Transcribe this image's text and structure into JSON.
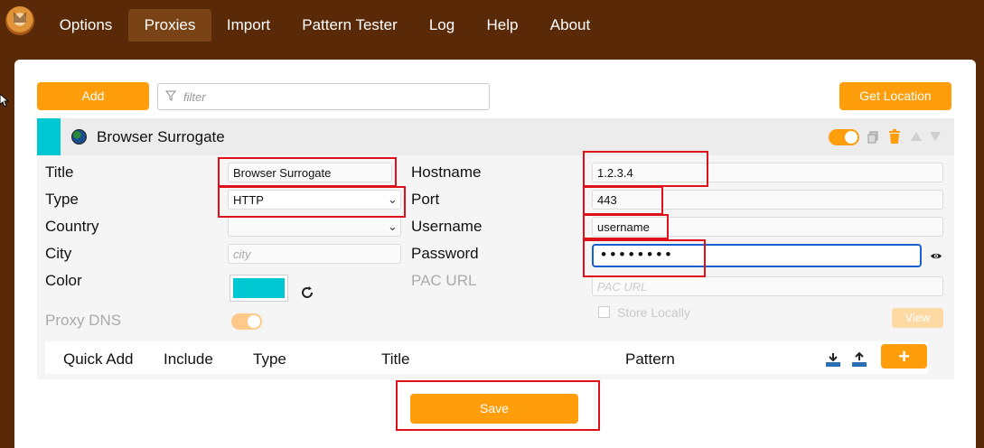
{
  "nav": {
    "tabs": [
      "Options",
      "Proxies",
      "Import",
      "Pattern Tester",
      "Log",
      "Help",
      "About"
    ],
    "active_tab": "Proxies"
  },
  "toolbar": {
    "add_label": "Add",
    "filter_placeholder": "filter",
    "get_location_label": "Get Location"
  },
  "proxy": {
    "name": "Browser Surrogate",
    "color": "#00c8d2",
    "enabled": true
  },
  "form": {
    "title_label": "Title",
    "title_value": "Browser Surrogate",
    "type_label": "Type",
    "type_value": "HTTP",
    "country_label": "Country",
    "country_value": "",
    "city_label": "City",
    "city_placeholder": "city",
    "color_label": "Color",
    "proxy_dns_label": "Proxy DNS",
    "hostname_label": "Hostname",
    "hostname_value": "1.2.3.4",
    "port_label": "Port",
    "port_value": "443",
    "username_label": "Username",
    "username_value": "username",
    "password_label": "Password",
    "password_value": "••••••••",
    "pac_url_label": "PAC URL",
    "pac_url_placeholder": "PAC URL",
    "store_locally_label": "Store Locally",
    "view_label": "View"
  },
  "patterns": {
    "columns": [
      "Quick Add",
      "Include",
      "Type",
      "Title",
      "Pattern"
    ]
  },
  "footer": {
    "save_label": "Save"
  },
  "icons": {
    "accent": "#ff9d0a",
    "highlight": "#e0101a"
  }
}
